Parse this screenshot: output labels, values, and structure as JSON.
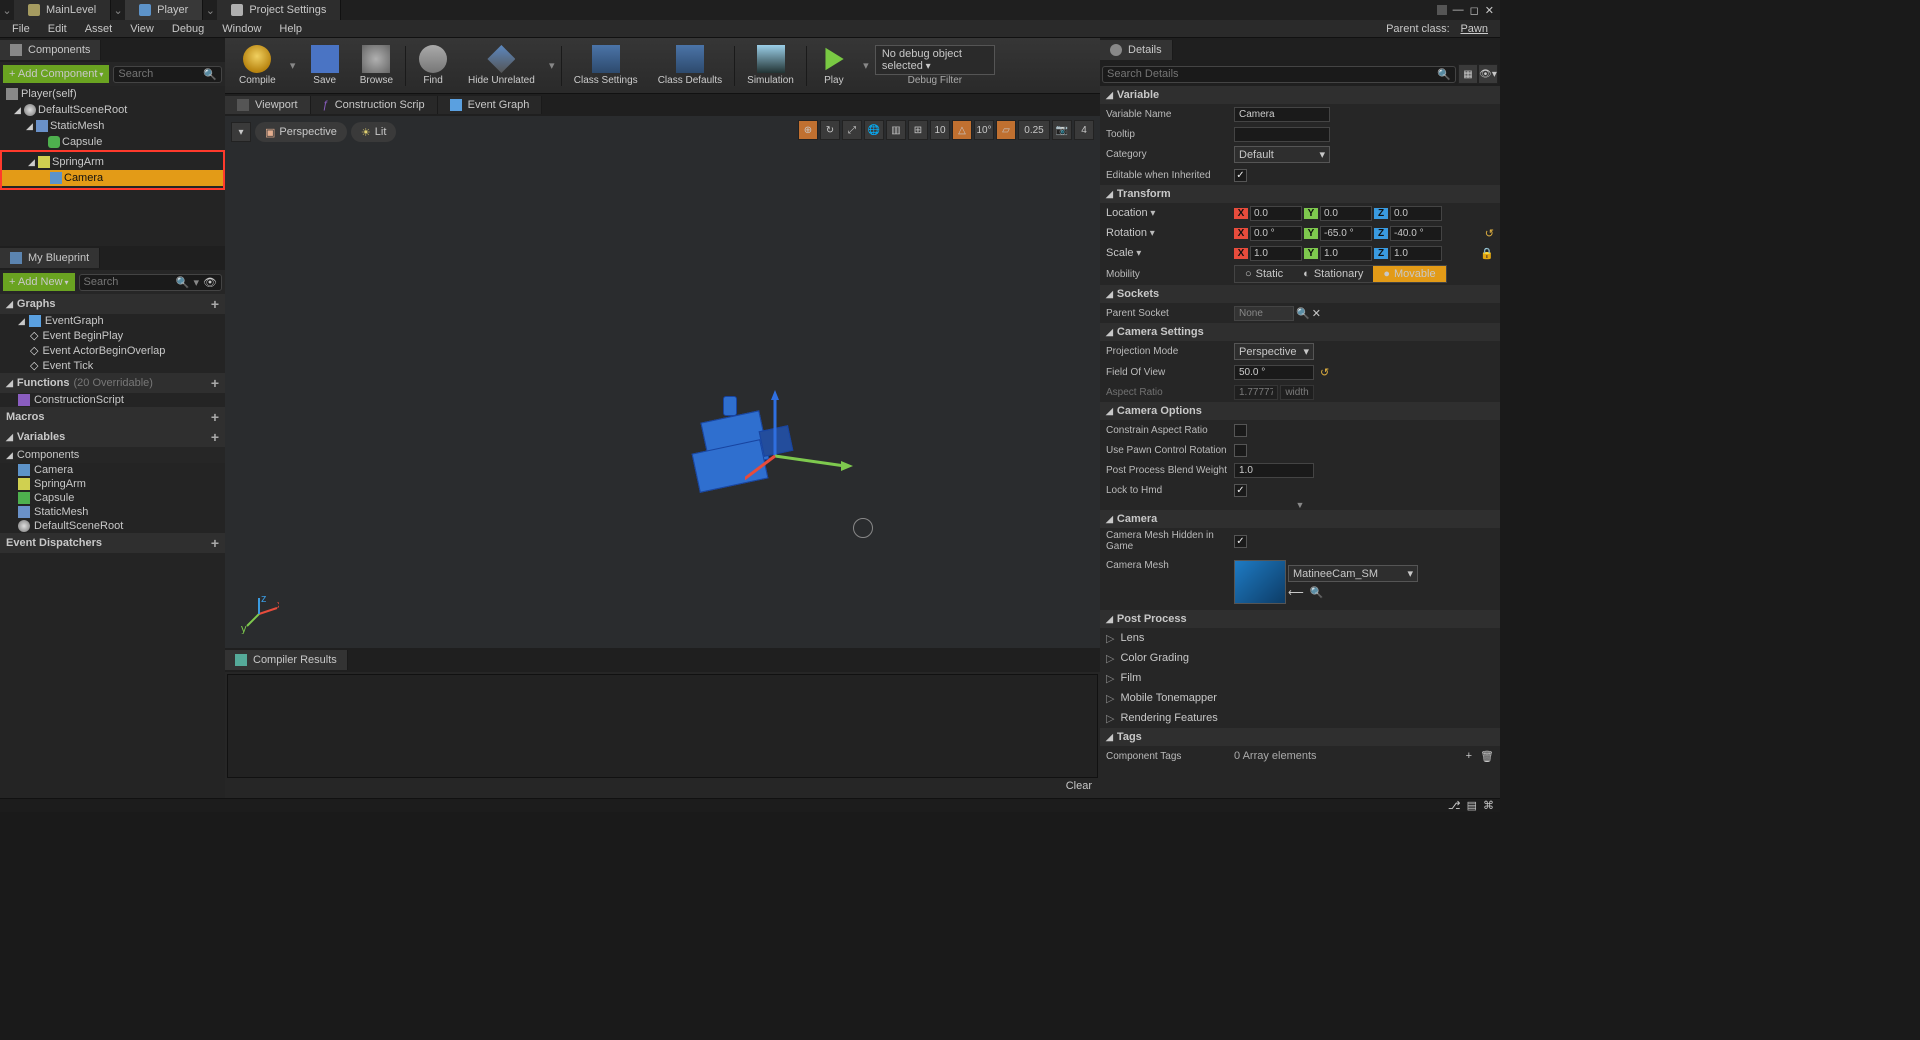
{
  "filetabs": [
    {
      "label": "MainLevel",
      "kind": "level"
    },
    {
      "label": "Player",
      "kind": "player",
      "active": true
    },
    {
      "label": "Project Settings",
      "kind": "settings"
    }
  ],
  "menu": [
    "File",
    "Edit",
    "Asset",
    "View",
    "Debug",
    "Window",
    "Help"
  ],
  "parent_class_label": "Parent class:",
  "parent_class": "Pawn",
  "components": {
    "title": "Components",
    "add_btn": "+ Add Component",
    "search_ph": "Search",
    "tree": [
      {
        "label": "Player(self)",
        "depth": 0,
        "icon": "none"
      },
      {
        "label": "DefaultSceneRoot",
        "depth": 1,
        "icon": "ball",
        "expand": true
      },
      {
        "label": "StaticMesh",
        "depth": 2,
        "icon": "cube",
        "expand": true
      },
      {
        "label": "Capsule",
        "depth": 3,
        "icon": "pill"
      },
      {
        "label": "SpringArm",
        "depth": 2,
        "icon": "spring",
        "expand": true,
        "hl": true
      },
      {
        "label": "Camera",
        "depth": 3,
        "icon": "cam",
        "selected": true,
        "hl": true
      }
    ]
  },
  "myblueprint": {
    "title": "My Blueprint",
    "add_btn": "+ Add New",
    "search_ph": "Search",
    "sections": {
      "graphs": {
        "title": "Graphs",
        "items": [
          "EventGraph",
          "Event BeginPlay",
          "Event ActorBeginOverlap",
          "Event Tick"
        ]
      },
      "functions": {
        "title": "Functions",
        "suffix": "(20 Overridable)",
        "items": [
          "ConstructionScript"
        ]
      },
      "macros": {
        "title": "Macros",
        "items": []
      },
      "variables": {
        "title": "Variables",
        "items": []
      },
      "components": {
        "title": "Components",
        "items": [
          "Camera",
          "SpringArm",
          "Capsule",
          "StaticMesh",
          "DefaultSceneRoot"
        ]
      },
      "dispatchers": {
        "title": "Event Dispatchers",
        "items": []
      }
    }
  },
  "toolbar": [
    {
      "label": "Compile",
      "icon": "compile",
      "dd": true
    },
    {
      "label": "Save",
      "icon": "save"
    },
    {
      "label": "Browse",
      "icon": "browse"
    },
    {
      "sep": true
    },
    {
      "label": "Find",
      "icon": "find"
    },
    {
      "label": "Hide Unrelated",
      "icon": "hide",
      "dd": true
    },
    {
      "sep": true
    },
    {
      "label": "Class Settings",
      "icon": "class"
    },
    {
      "label": "Class Defaults",
      "icon": "class"
    },
    {
      "sep": true
    },
    {
      "label": "Simulation",
      "icon": "sim"
    },
    {
      "sep": true
    },
    {
      "label": "Play",
      "icon": "play",
      "dd": true
    }
  ],
  "debug": {
    "selected": "No debug object selected",
    "label": "Debug Filter"
  },
  "viewport_tabs": [
    "Viewport",
    "Construction Scrip",
    "Event Graph"
  ],
  "viewport_mode": {
    "perspective": "Perspective",
    "lit": "Lit"
  },
  "vp_icons": {
    "grid": "10",
    "angle": "10°",
    "scale": "0.25",
    "cam": "4"
  },
  "compiler": {
    "title": "Compiler Results",
    "clear": "Clear"
  },
  "details": {
    "title": "Details",
    "search_ph": "Search Details",
    "variable": {
      "title": "Variable",
      "name_lbl": "Variable Name",
      "name": "Camera",
      "tooltip_lbl": "Tooltip",
      "tooltip": "",
      "category_lbl": "Category",
      "category": "Default",
      "inherited_lbl": "Editable when Inherited",
      "inherited": true
    },
    "transform": {
      "title": "Transform",
      "location_lbl": "Location",
      "location": [
        "0.0",
        "0.0",
        "0.0"
      ],
      "rotation_lbl": "Rotation",
      "rotation": [
        "0.0 °",
        "-65.0 °",
        "-40.0 °"
      ],
      "scale_lbl": "Scale",
      "scale": [
        "1.0",
        "1.0",
        "1.0"
      ],
      "mobility_lbl": "Mobility",
      "mobility": [
        "Static",
        "Stationary",
        "Movable"
      ]
    },
    "sockets": {
      "title": "Sockets",
      "parent_lbl": "Parent Socket",
      "parent": "None"
    },
    "camsettings": {
      "title": "Camera Settings",
      "proj_lbl": "Projection Mode",
      "proj": "Perspective",
      "fov_lbl": "Field Of View",
      "fov": "50.0 °",
      "aspect_lbl": "Aspect Ratio",
      "aspect": "1.777778",
      "aspect_btn": "width"
    },
    "camoptions": {
      "title": "Camera Options",
      "constrain_lbl": "Constrain Aspect Ratio",
      "constrain": false,
      "pawn_lbl": "Use Pawn Control Rotation",
      "pawn": false,
      "blend_lbl": "Post Process Blend Weight",
      "blend": "1.0",
      "hmd_lbl": "Lock to Hmd",
      "hmd": true
    },
    "camera": {
      "title": "Camera",
      "hidden_lbl": "Camera Mesh Hidden in Game",
      "hidden": true,
      "mesh_lbl": "Camera Mesh",
      "mesh": "MatineeCam_SM"
    },
    "post": {
      "title": "Post Process",
      "items": [
        "Lens",
        "Color Grading",
        "Film",
        "Mobile Tonemapper",
        "Rendering Features"
      ]
    },
    "tags": {
      "title": "Tags",
      "comp_lbl": "Component Tags",
      "comp_val": "0 Array elements"
    }
  }
}
